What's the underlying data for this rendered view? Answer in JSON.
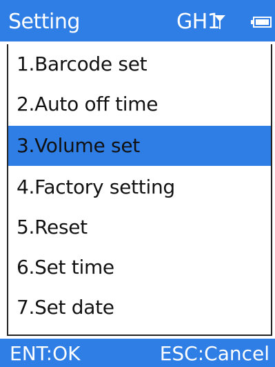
{
  "header": {
    "title": "Setting",
    "signal_label": "GH1",
    "antenna_icon": "antenna-icon",
    "battery_icon": "battery-icon"
  },
  "menu": {
    "items": [
      {
        "label": "1.Barcode set",
        "selected": false
      },
      {
        "label": "2.Auto off time",
        "selected": false
      },
      {
        "label": "3.Volume set",
        "selected": true
      },
      {
        "label": "4.Factory setting",
        "selected": false
      },
      {
        "label": "5.Reset",
        "selected": false
      },
      {
        "label": "6.Set time",
        "selected": false
      },
      {
        "label": "7.Set date",
        "selected": false
      }
    ]
  },
  "footer": {
    "ok_label": "ENT:OK",
    "cancel_label": "ESC:Cancel"
  },
  "colors": {
    "accent": "#2e7ee6",
    "text": "#111111",
    "background": "#ffffff"
  }
}
